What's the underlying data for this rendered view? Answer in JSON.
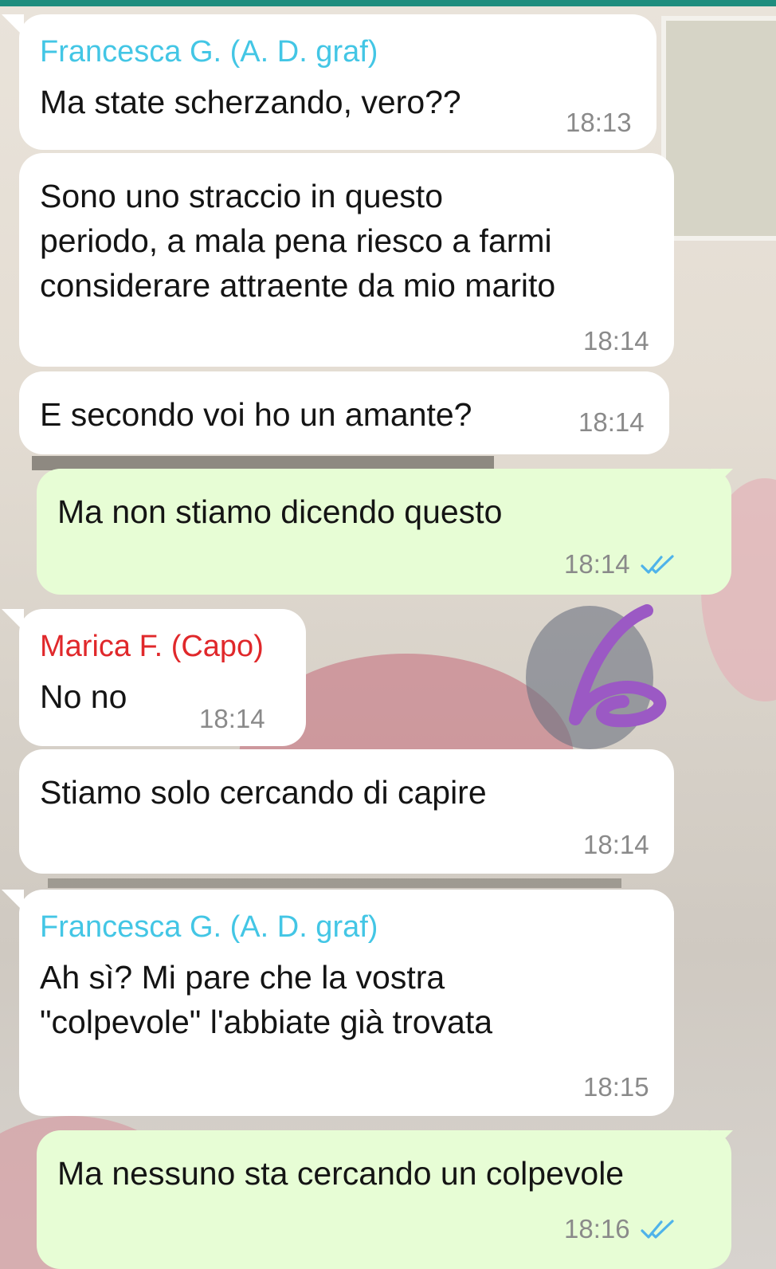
{
  "colors": {
    "incoming_bubble": "#ffffff",
    "outgoing_bubble": "#e7fdd5",
    "timestamp": "#8a8a8a",
    "read_ticks": "#4fb3ea",
    "sender_francesca": "#43c6e5",
    "sender_marica": "#e0282b",
    "status_bar": "#1e8d7e",
    "scribble": "#9b59c4"
  },
  "messages": [
    {
      "id": "m1",
      "direction": "in",
      "sender": "Francesca G. (A. D. graf)",
      "sender_color": "#43c6e5",
      "text": "Ma state scherzando, vero??",
      "time": "18:13"
    },
    {
      "id": "m2",
      "direction": "in",
      "text": "Sono uno straccio in questo\nperiodo, a mala pena riesco a farmi\nconsiderare attraente da mio marito",
      "time": "18:14"
    },
    {
      "id": "m3",
      "direction": "in",
      "text": "E secondo voi ho un amante?",
      "time": "18:14"
    },
    {
      "id": "m4",
      "direction": "out",
      "text": "Ma non stiamo dicendo questo",
      "time": "18:14",
      "status": "read"
    },
    {
      "id": "m5",
      "direction": "in",
      "sender": "Marica F. (Capo)",
      "sender_color": "#e0282b",
      "text": "No no",
      "time": "18:14"
    },
    {
      "id": "m6",
      "direction": "in",
      "text": "Stiamo solo cercando di capire",
      "time": "18:14"
    },
    {
      "id": "m7",
      "direction": "in",
      "sender": "Francesca G. (A. D. graf)",
      "sender_color": "#43c6e5",
      "text": "Ah sì? Mi pare che la vostra\n\"colpevole\" l'abbiate già trovata",
      "time": "18:15"
    },
    {
      "id": "m8",
      "direction": "out",
      "text": "Ma nessuno sta cercando un colpevole",
      "time": "18:16",
      "status": "read"
    }
  ],
  "icons": {
    "read_receipt": "double-check-icon",
    "annotation": "handwritten-six-scribble"
  }
}
